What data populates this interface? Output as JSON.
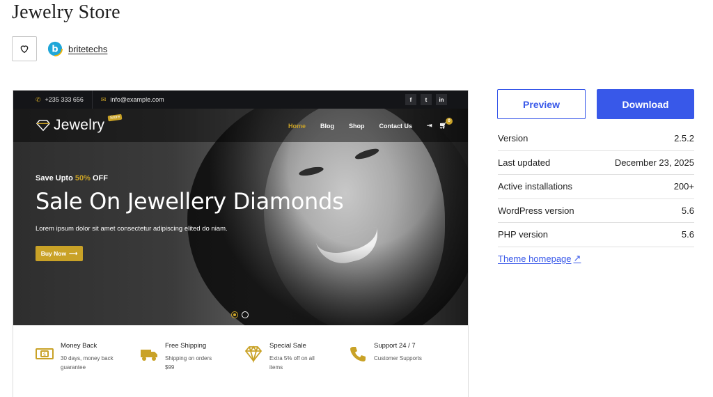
{
  "page": {
    "title": "Jewelry Store"
  },
  "author": {
    "name": "britetechs"
  },
  "preview_image": {
    "topbar": {
      "phone": "+235 333 656",
      "email": "info@example.com",
      "socials": [
        "f",
        "t",
        "in"
      ]
    },
    "logo": {
      "text": "Jewelry",
      "badge": "Store"
    },
    "nav": [
      "Home",
      "Blog",
      "Shop",
      "Contact Us"
    ],
    "cart_count": "0",
    "hero": {
      "tag_prefix": "Save Upto",
      "tag_percent": "50%",
      "tag_suffix": "OFF",
      "title": "Sale On Jewellery Diamonds",
      "description": "Lorem ipsum dolor sit amet consectetur adipiscing elited do niam.",
      "button": "Buy Now"
    },
    "features": [
      {
        "title": "Money Back",
        "subtitle": "30 days, money back guarantee",
        "icon": "money-icon"
      },
      {
        "title": "Free Shipping",
        "subtitle": "Shipping on orders $99",
        "icon": "truck-icon"
      },
      {
        "title": "Special Sale",
        "subtitle": "Extra 5% off on all items",
        "icon": "diamond-icon"
      },
      {
        "title": "Support 24 / 7",
        "subtitle": "Customer Supports",
        "icon": "phone-icon"
      }
    ]
  },
  "actions": {
    "preview": "Preview",
    "download": "Download"
  },
  "meta": {
    "rows": [
      {
        "label": "Version",
        "value": "2.5.2"
      },
      {
        "label": "Last updated",
        "value": "December 23, 2025"
      },
      {
        "label": "Active installations",
        "value": "200+"
      },
      {
        "label": "WordPress version",
        "value": "5.6"
      },
      {
        "label": "PHP version",
        "value": "5.6"
      }
    ],
    "homepage_link": "Theme homepage"
  },
  "colors": {
    "accent": "#3858e9",
    "gold": "#c9a227"
  }
}
